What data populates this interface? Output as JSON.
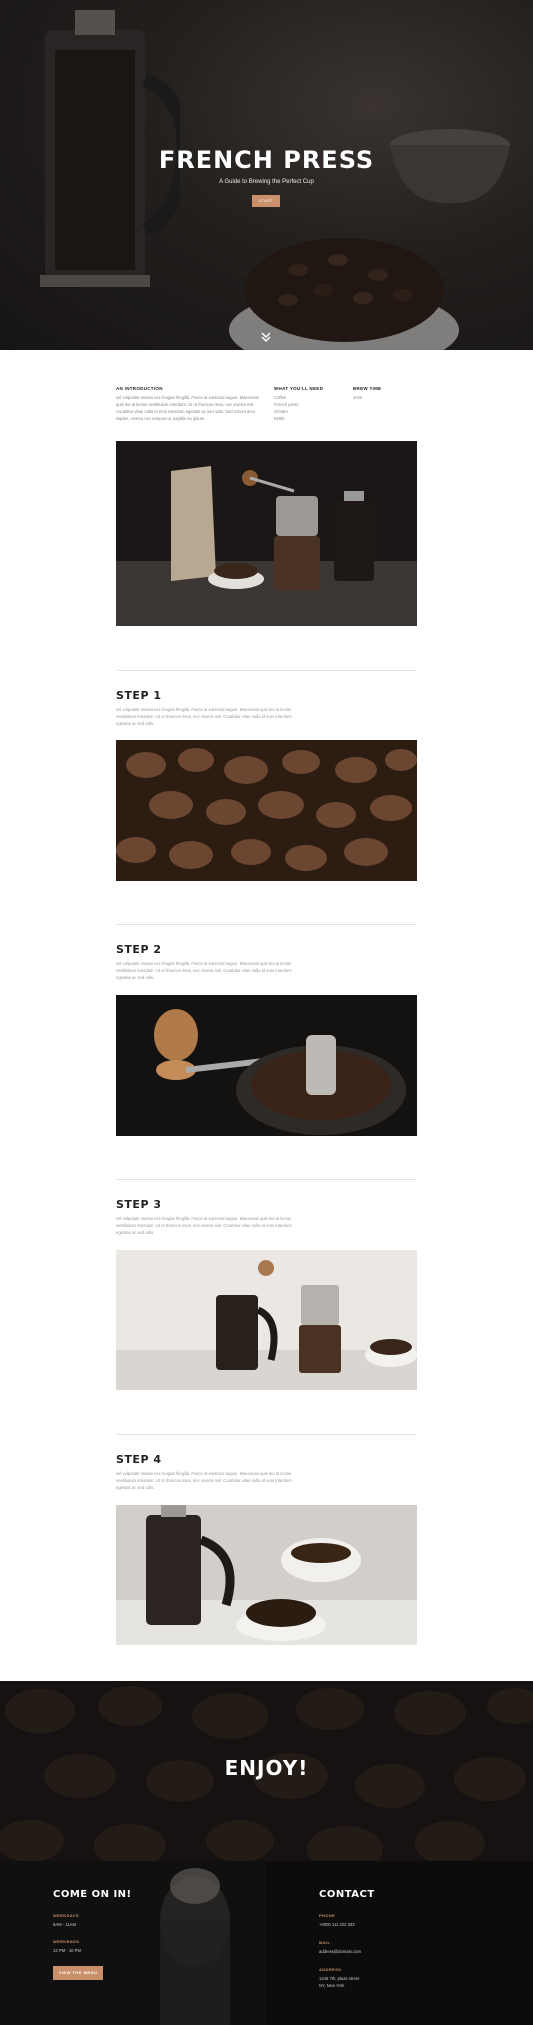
{
  "hero": {
    "title": "FRENCH PRESS",
    "subtitle": "A Guide to Brewing the Perfect Cup",
    "button_label": "START"
  },
  "intro": {
    "col1_heading": "AN INTRODUCTION",
    "col1_text": "vel vulputate massa nec feugiat fringilla. Fusce at euismod augue. Maecenas quis leo at lectus vestibulum interdum. Ut ut rhoncus risus, nec viverra nisl. Curabitur vitae nulla id eros interdum egestas ac sed odio. Sed rutrum arcu sapien, viverra nec tempus ut, sagittis eu ipsum.",
    "col2_heading": "WHAT YOU'LL NEED",
    "col2_items": [
      "Coffee",
      "French press",
      "Grinder",
      "Kettle"
    ],
    "col3_heading": "BREW TIME",
    "col3_text": "4min"
  },
  "steps": [
    {
      "title": "STEP 1",
      "text": "vel vulputate massa nec feugiat fringilla. Fusce at euismod augue. Maecenas quis leo at lectus vestibulum interdum. Ut ut rhoncus risus, nec viverra nisl. Curabitur vitae nulla id eros interdum egestas ac sed odio."
    },
    {
      "title": "STEP 2",
      "text": "vel vulputate massa nec feugiat fringilla. Fusce at euismod augue. Maecenas quis leo at lectus vestibulum interdum. Ut ut rhoncus risus, nec viverra nisl. Curabitur vitae nulla id eros interdum egestas ac sed odio."
    },
    {
      "title": "STEP 3",
      "text": "vel vulputate massa nec feugiat fringilla. Fusce at euismod augue. Maecenas quis leo at lectus vestibulum interdum. Ut ut rhoncus risus, nec viverra nisl. Curabitur vitae nulla id eros interdum egestas ac sed odio."
    },
    {
      "title": "STEP 4",
      "text": "vel vulputate massa nec feugiat fringilla. Fusce at euismod augue. Maecenas quis leo at lectus vestibulum interdum. Ut ut rhoncus risus, nec viverra nisl. Curabitur vitae nulla id eros interdum egestas ac sed odio."
    }
  ],
  "enjoy": {
    "title": "ENJOY!"
  },
  "footer": {
    "left_title": "COME ON IN!",
    "weekdays_label": "WEEKDAYS",
    "weekdays_value": "6AM - 11AM",
    "weekends_label": "WEEKENDS",
    "weekends_value": "12 PM - 10 PM",
    "button_label": "VIEW THE MENU",
    "right_title": "CONTACT",
    "phone_label": "PHONE",
    "phone_value": "+0000 111 222 333",
    "mail_label": "MAIL",
    "mail_value": "address@domain.com",
    "address_label": "ADDRESS",
    "address_line1": "1245 7th, plaza street",
    "address_line2": "NY, New York"
  },
  "colors": {
    "accent": "#c9906a",
    "dark": "#0c0c0c"
  },
  "icons": {
    "scroll": "double-chevron-down-icon"
  }
}
